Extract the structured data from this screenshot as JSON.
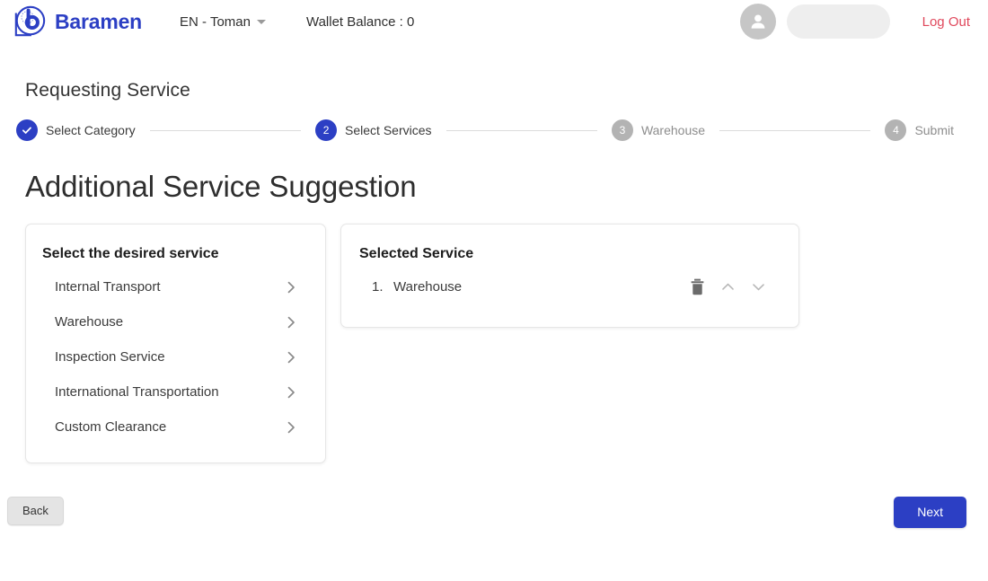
{
  "header": {
    "brand_name": "Baramen",
    "logo_icon": "baramen-b-logo",
    "language_selector": {
      "label": "EN - Toman",
      "caret_icon": "chevron-down-icon"
    },
    "wallet_label": "Wallet Balance : 0",
    "avatar_icon": "user-avatar-icon",
    "logout_label": "Log Out",
    "colors": {
      "brand_blue": "#2c3fc4",
      "logout_red": "#e0485c",
      "avatar_gray": "#c6c6c6",
      "skeleton_gray": "#eeeeee"
    }
  },
  "page": {
    "title": "Requesting Service",
    "main_heading": "Additional Service Suggestion"
  },
  "stepper": {
    "steps": [
      {
        "number": "1",
        "label": "Select Category",
        "state": "done",
        "icon": "check-icon"
      },
      {
        "number": "2",
        "label": "Select Services",
        "state": "active",
        "icon": ""
      },
      {
        "number": "3",
        "label": "Warehouse",
        "state": "todo",
        "icon": ""
      },
      {
        "number": "4",
        "label": "Submit",
        "state": "todo",
        "icon": ""
      }
    ],
    "active_color": "#2c3fc4",
    "inactive_color": "#b3b3b3"
  },
  "available_services": {
    "title": "Select the desired service",
    "items": [
      {
        "label": "Internal Transport",
        "chevron_icon": "chevron-right-icon"
      },
      {
        "label": "Warehouse",
        "chevron_icon": "chevron-right-icon"
      },
      {
        "label": "Inspection Service",
        "chevron_icon": "chevron-right-icon"
      },
      {
        "label": "International Transportation",
        "chevron_icon": "chevron-right-icon"
      },
      {
        "label": "Custom Clearance",
        "chevron_icon": "chevron-right-icon"
      }
    ]
  },
  "selected_services": {
    "title": "Selected Service",
    "items": [
      {
        "index": "1.",
        "label": "Warehouse",
        "actions": {
          "delete_icon": "trash-icon",
          "move_up_icon": "chevron-up-icon",
          "move_down_icon": "chevron-down-icon"
        }
      }
    ]
  },
  "footer": {
    "back_label": "Back",
    "next_label": "Next",
    "next_color": "#2c3fc4",
    "back_color": "#e4e4e4"
  }
}
